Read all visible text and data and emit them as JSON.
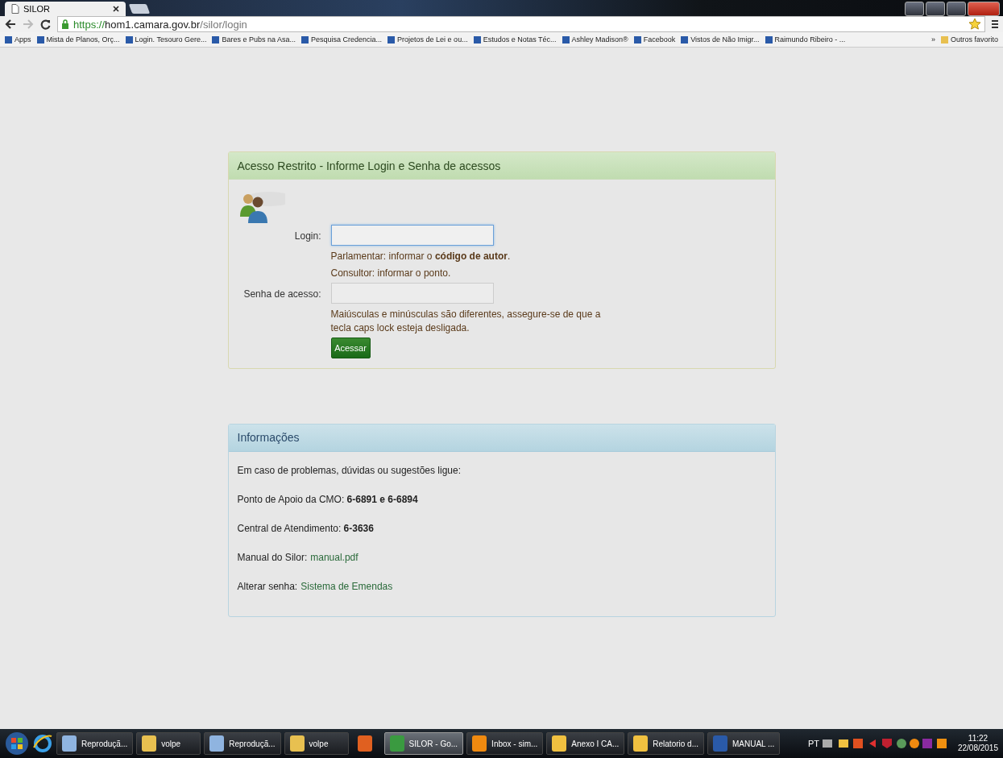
{
  "browser": {
    "tab": {
      "title": "SILOR"
    },
    "address": {
      "scheme": "https://",
      "host": "hom1.camara.gov.br",
      "path": "/silor/login"
    },
    "bookmarks": [
      "Apps",
      "Mista de Planos, Orç...",
      "Login. Tesouro Gere...",
      "Bares e Pubs na Asa...",
      "Pesquisa Credencia...",
      "Projetos de Lei e ou...",
      "Estudos e Notas Téc...",
      "Ashley Madison®",
      "Facebook",
      "Vistos de Não Imigr...",
      "Raimundo Ribeiro - ..."
    ],
    "more": "»",
    "other_bookmarks": "Outros favorito"
  },
  "login_panel": {
    "title": "Acesso Restrito - Informe Login e Senha de acessos",
    "fields": [
      {
        "label": "Login:",
        "focused": true,
        "hints": [
          "Parlamentar: informar o **código de autor**.",
          "Consultor: informar o ponto."
        ]
      },
      {
        "label": "Senha de acesso:",
        "focused": false,
        "hints": [
          "Maiúsculas e minúsculas são diferentes, assegure-se de que a tecla caps lock esteja desligada."
        ]
      }
    ],
    "button": "Acessar"
  },
  "info_panel": {
    "title": "Informações",
    "lines": [
      {
        "text": "Em caso de problemas, dúvidas ou sugestões ligue:"
      },
      {
        "text": "Ponto de Apoio da CMO: **6-6891 e 6-6894**"
      },
      {
        "text": "Central de Atendimento: **6-3636**"
      },
      {
        "text": "Manual do Silor:",
        "link": "manual.pdf"
      },
      {
        "text": "Alterar senha:",
        "link": "Sistema de Emendas"
      }
    ]
  },
  "taskbar": {
    "items": [
      {
        "label": "Reproduçã...",
        "kind": "player",
        "selected": false
      },
      {
        "label": "volpe",
        "kind": "folder",
        "selected": false
      },
      {
        "label": "Reproduçã...",
        "kind": "player",
        "selected": false
      },
      {
        "label": "volpe",
        "kind": "folder",
        "selected": false
      },
      {
        "kind": "media",
        "selected": false
      },
      {
        "label": "SILOR - Go...",
        "kind": "browser",
        "selected": true
      },
      {
        "label": "Inbox - sim...",
        "kind": "outlook",
        "selected": false
      },
      {
        "label": "Anexo I CA...",
        "kind": "mail",
        "selected": false
      },
      {
        "label": "Relatorio d...",
        "kind": "mail",
        "selected": false
      },
      {
        "label": "MANUAL ...",
        "kind": "word",
        "selected": false
      }
    ],
    "language": "PT",
    "time": "11:22",
    "date": "22/08/2015"
  }
}
